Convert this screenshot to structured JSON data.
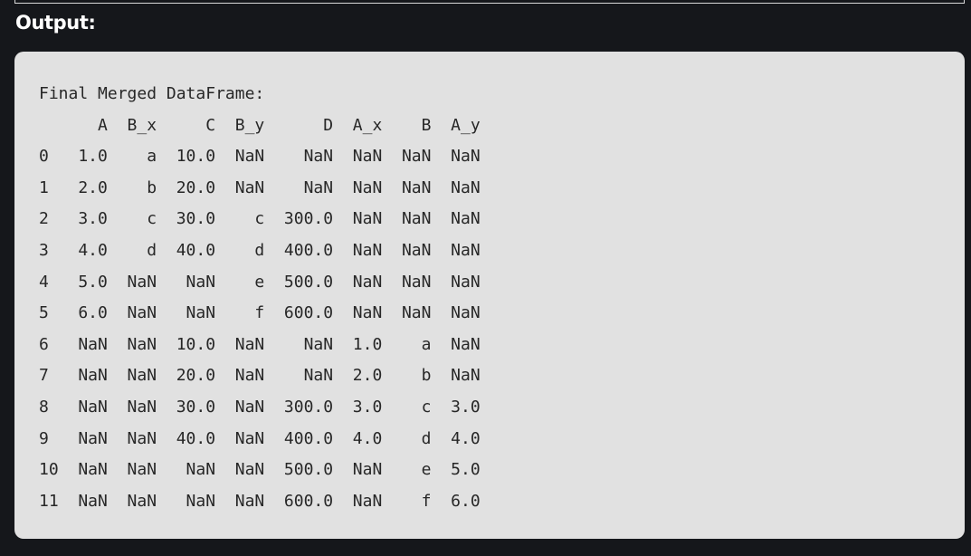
{
  "header": {
    "label": "Output:"
  },
  "output": {
    "lines": [
      "Final Merged DataFrame:",
      "      A  B_x     C  B_y      D  A_x    B  A_y",
      "0   1.0    a  10.0  NaN    NaN  NaN  NaN  NaN",
      "1   2.0    b  20.0  NaN    NaN  NaN  NaN  NaN",
      "2   3.0    c  30.0    c  300.0  NaN  NaN  NaN",
      "3   4.0    d  40.0    d  400.0  NaN  NaN  NaN",
      "4   5.0  NaN   NaN    e  500.0  NaN  NaN  NaN",
      "5   6.0  NaN   NaN    f  600.0  NaN  NaN  NaN",
      "6   NaN  NaN  10.0  NaN    NaN  1.0    a  NaN",
      "7   NaN  NaN  20.0  NaN    NaN  2.0    b  NaN",
      "8   NaN  NaN  30.0  NaN  300.0  3.0    c  3.0",
      "9   NaN  NaN  40.0  NaN  400.0  4.0    d  4.0",
      "10  NaN  NaN   NaN  NaN  500.0  NaN    e  5.0",
      "11  NaN  NaN   NaN  NaN  600.0  NaN    f  6.0"
    ]
  }
}
